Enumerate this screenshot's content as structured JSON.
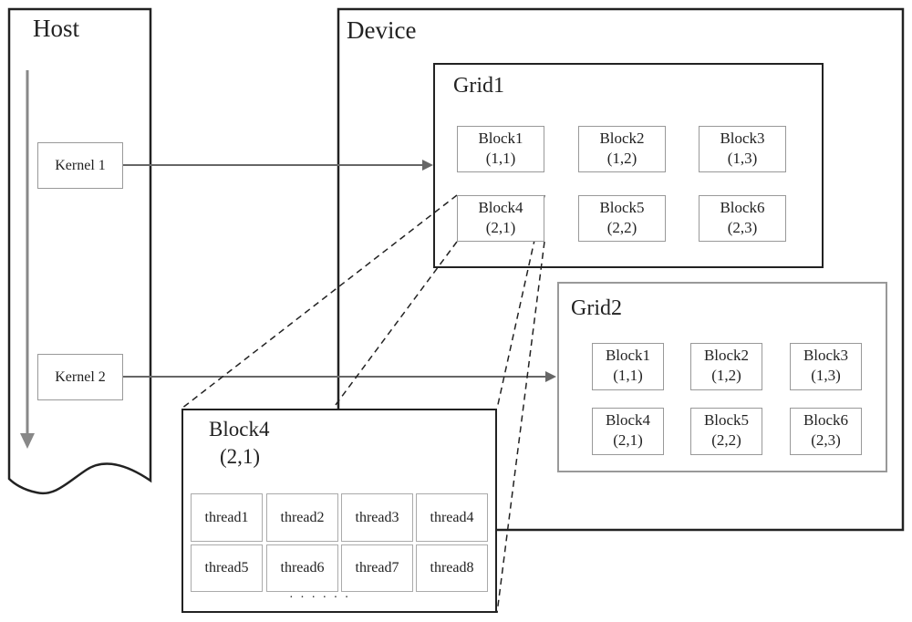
{
  "host": {
    "title": "Host",
    "kernels": [
      {
        "label": "Kernel 1"
      },
      {
        "label": "Kernel 2"
      }
    ]
  },
  "device": {
    "title": "Device",
    "grids": [
      {
        "title": "Grid1",
        "blocks": [
          {
            "name": "Block1",
            "coord": "(1,1)"
          },
          {
            "name": "Block2",
            "coord": "(1,2)"
          },
          {
            "name": "Block3",
            "coord": "(1,3)"
          },
          {
            "name": "Block4",
            "coord": "(2,1)"
          },
          {
            "name": "Block5",
            "coord": "(2,2)"
          },
          {
            "name": "Block6",
            "coord": "(2,3)"
          }
        ]
      },
      {
        "title": "Grid2",
        "blocks": [
          {
            "name": "Block1",
            "coord": "(1,1)"
          },
          {
            "name": "Block2",
            "coord": "(1,2)"
          },
          {
            "name": "Block3",
            "coord": "(1,3)"
          },
          {
            "name": "Block4",
            "coord": "(2,1)"
          },
          {
            "name": "Block5",
            "coord": "(2,2)"
          },
          {
            "name": "Block6",
            "coord": "(2,3)"
          }
        ]
      }
    ]
  },
  "expanded_block": {
    "name": "Block4",
    "coord": "(2,1)",
    "threads": [
      "thread1",
      "thread2",
      "thread3",
      "thread4",
      "thread5",
      "thread6",
      "thread7",
      "thread8"
    ],
    "ellipsis": "· · · · · ·"
  },
  "colors": {
    "line": "#222222",
    "arrow": "#666666",
    "box_border": "#999999"
  }
}
